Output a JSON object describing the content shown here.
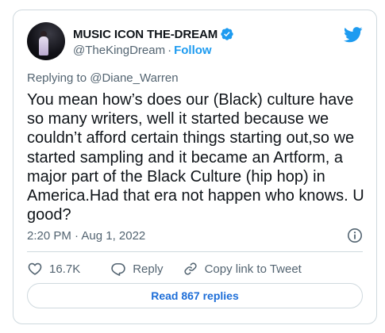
{
  "author": {
    "name": "MUSIC ICON THE-DREAM",
    "handle": "@TheKingDream",
    "separator": "·",
    "follow_label": "Follow",
    "verified_icon": "verified-badge-icon",
    "avatar": "avatar"
  },
  "brand": {
    "icon": "twitter-bird-icon",
    "color": "#1d9bf0"
  },
  "reply_context": "Replying to @Diane_Warren",
  "tweet": {
    "text": "You mean how’s does our (Black) culture have so many writers, well it started because we couldn’t afford certain things starting out,so we started sampling and it became an Artform, a major part of the Black Culture (hip hop) in America.Had that era not happen who knows. U good?",
    "timestamp": "2:20 PM · Aug 1, 2022"
  },
  "actions": {
    "likes_count": "16.7K",
    "reply_label": "Reply",
    "copy_link_label": "Copy link to Tweet",
    "read_replies_label": "Read 867 replies"
  },
  "colors": {
    "text_primary": "#0f1419",
    "text_secondary": "#536471",
    "border": "#cfd9de",
    "link": "#1d9bf0"
  }
}
